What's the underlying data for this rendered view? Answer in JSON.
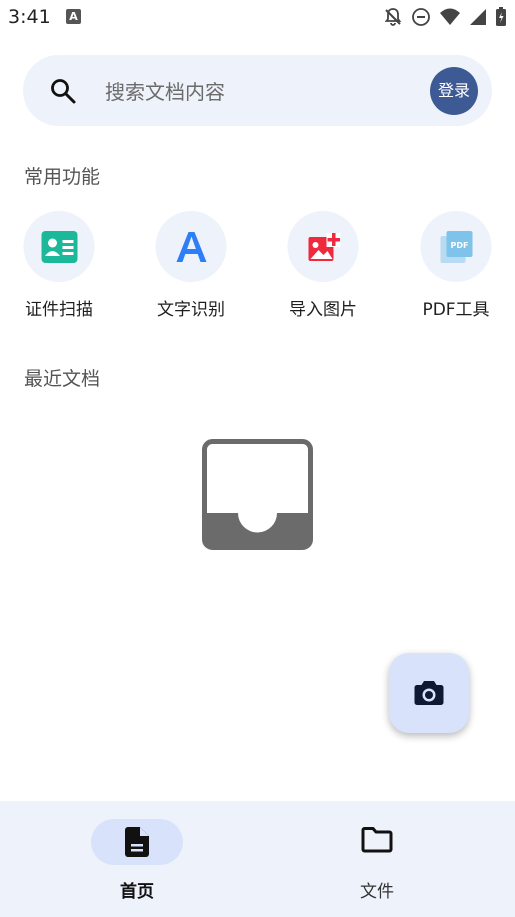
{
  "status_bar": {
    "time": "3:41",
    "notification_icon": "A"
  },
  "search": {
    "placeholder": "搜索文档内容",
    "login_label": "登录"
  },
  "sections": {
    "common": "常用功能",
    "recent": "最近文档"
  },
  "functions": [
    {
      "label": "证件扫描",
      "icon": "id-card-icon",
      "color": "#1cb89a"
    },
    {
      "label": "文字识别",
      "icon": "text-a-icon",
      "color": "#2d7ef7"
    },
    {
      "label": "导入图片",
      "icon": "add-image-icon",
      "color": "#ee2a3c"
    },
    {
      "label": "PDF工具",
      "icon": "pdf-icon",
      "color": "#7fc3ea"
    }
  ],
  "recent_documents": [],
  "fab": {
    "icon": "camera-icon"
  },
  "bottom_nav": {
    "home_label": "首页",
    "files_label": "文件",
    "active": "home"
  },
  "colors": {
    "accent": "#3e5a95",
    "surface": "#eef2fb",
    "pill": "#d8e3fb"
  }
}
